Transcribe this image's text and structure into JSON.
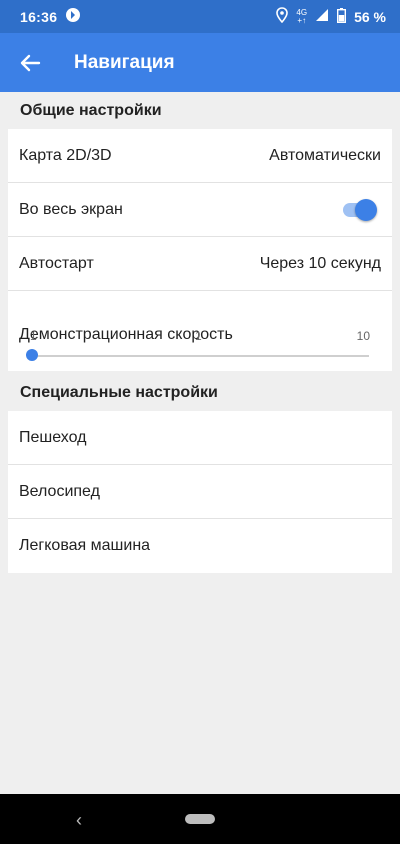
{
  "status_bar": {
    "time": "16:36",
    "network_top": "4G",
    "network_bottom": "+↑",
    "battery": "56 %"
  },
  "app_bar": {
    "title": "Навигация"
  },
  "general": {
    "header": "Общие настройки",
    "map_label": "Карта 2D/3D",
    "map_value": "Автоматически",
    "fullscreen_label": "Во весь экран",
    "fullscreen_on": true,
    "autostart_label": "Автостарт",
    "autostart_value": "Через 10 секунд",
    "demo_speed_label": "Демонстрационная скорость",
    "demo_speed_min": "1",
    "demo_speed_current": "1",
    "demo_speed_max": "10"
  },
  "special": {
    "header": "Специальные настройки",
    "items": [
      "Пешеход",
      "Велосипед",
      "Легковая машина"
    ]
  },
  "colors": {
    "status_bar": "#2f6fc9",
    "app_bar": "#3c80e6",
    "accent": "#3c80e6",
    "background": "#efefef"
  }
}
